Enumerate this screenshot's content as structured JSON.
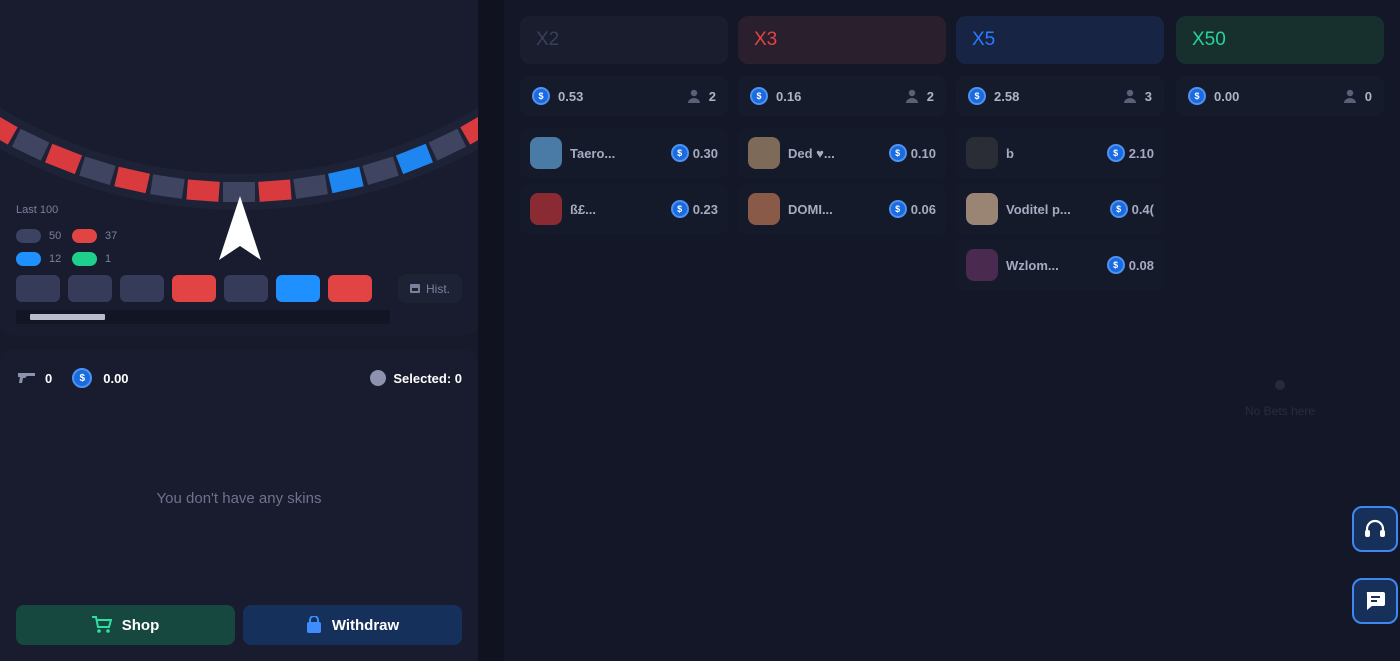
{
  "wheel": {
    "last_label": "Last 100",
    "stats": [
      {
        "color": "#3c4262",
        "count": "50"
      },
      {
        "color": "#e24444",
        "count": "37"
      },
      {
        "color": "#1e90ff",
        "count": "12"
      },
      {
        "color": "#1fcf8c",
        "count": "1"
      }
    ],
    "history": [
      "#363b5a",
      "#363b5a",
      "#363b5a",
      "#e24444",
      "#363b5a",
      "#1e90ff",
      "#e24444"
    ],
    "history_button": "Hist.",
    "tiles": [
      "red",
      "gray",
      "red",
      "gray",
      "red",
      "gray",
      "red",
      "gray",
      "red",
      "gray",
      "blue",
      "gray",
      "blue",
      "gray",
      "red"
    ]
  },
  "inventory": {
    "gun_count": "0",
    "balance": "0.00",
    "selected": "Selected: 0",
    "empty_message": "You don't have any skins",
    "shop_label": "Shop",
    "withdraw_label": "Withdraw"
  },
  "columns": [
    {
      "label": "X2",
      "accent": "#3a3f56",
      "bg": "#191d2d",
      "total": "0.53",
      "players": "2",
      "bets": [
        {
          "name": "Taero...",
          "amount": "0.30",
          "avatar": "#4a7aa6"
        },
        {
          "name": "ß£...",
          "amount": "0.23",
          "avatar": "#8a2a33"
        }
      ]
    },
    {
      "label": "X3",
      "accent": "#7e2d35",
      "bg": "#2a1f2c",
      "total": "0.16",
      "players": "2",
      "bets": [
        {
          "name": "Ded ♥...",
          "amount": "0.10",
          "avatar": "#7d6a58"
        },
        {
          "name": "DOMI...",
          "amount": "0.06",
          "avatar": "#8a5a48"
        }
      ]
    },
    {
      "label": "X5",
      "accent": "#1f4e9a",
      "bg": "#172444",
      "total": "2.58",
      "players": "3",
      "bets": [
        {
          "name": "b",
          "amount": "2.10",
          "avatar": "#2a2d36"
        },
        {
          "name": "Voditel p...",
          "amount": "0.4(",
          "avatar": "#9a8474"
        },
        {
          "name": "Wzlom...",
          "amount": "0.08",
          "avatar": "#4a2a4e"
        }
      ]
    },
    {
      "label": "X50",
      "accent": "#1a8a63",
      "bg": "#17302e",
      "total": "0.00",
      "players": "0",
      "bets": [],
      "empty": "No Bets here"
    }
  ]
}
